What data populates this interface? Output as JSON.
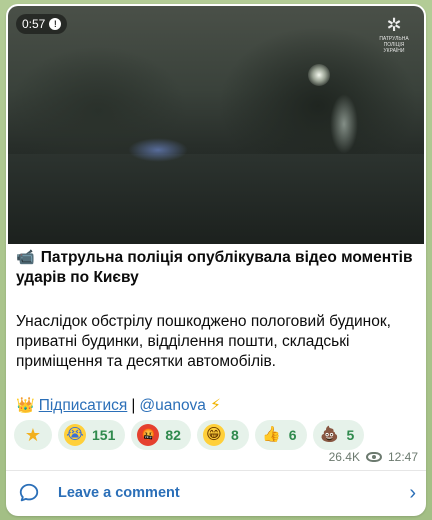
{
  "video": {
    "duration": "0:57",
    "logo_caption": "ПАТРУЛЬНА ПОЛІЦІЯ УКРАЇНИ"
  },
  "post": {
    "headline_icon": "video-camera-icon",
    "headline": "Патрульна поліція опублікувала відео моментів ударів по Києву",
    "body": "Унаслідок обстрілу пошкоджено пологовий будинок, приватні будинки, відділення пошти, складські приміщення та десятки автомобілів.",
    "subscribe_link": "Підписатися",
    "separator": "|",
    "handle": "@uanova"
  },
  "reactions": [
    {
      "icon": "star-icon",
      "count": ""
    },
    {
      "icon": "crying-face-icon",
      "count": "151"
    },
    {
      "icon": "angry-face-icon",
      "count": "82"
    },
    {
      "icon": "grinning-face-icon",
      "count": "8"
    },
    {
      "icon": "thumbs-up-icon",
      "count": "6"
    },
    {
      "icon": "poop-icon",
      "count": "5"
    }
  ],
  "meta": {
    "views": "26.4K",
    "time": "12:47"
  },
  "comment": {
    "label": "Leave a comment"
  },
  "colors": {
    "accent": "#2b6fb8",
    "reaction_text": "#2f8a4d",
    "reaction_bg": "#e6f2ea",
    "chat_bg": "#a9c48c"
  }
}
